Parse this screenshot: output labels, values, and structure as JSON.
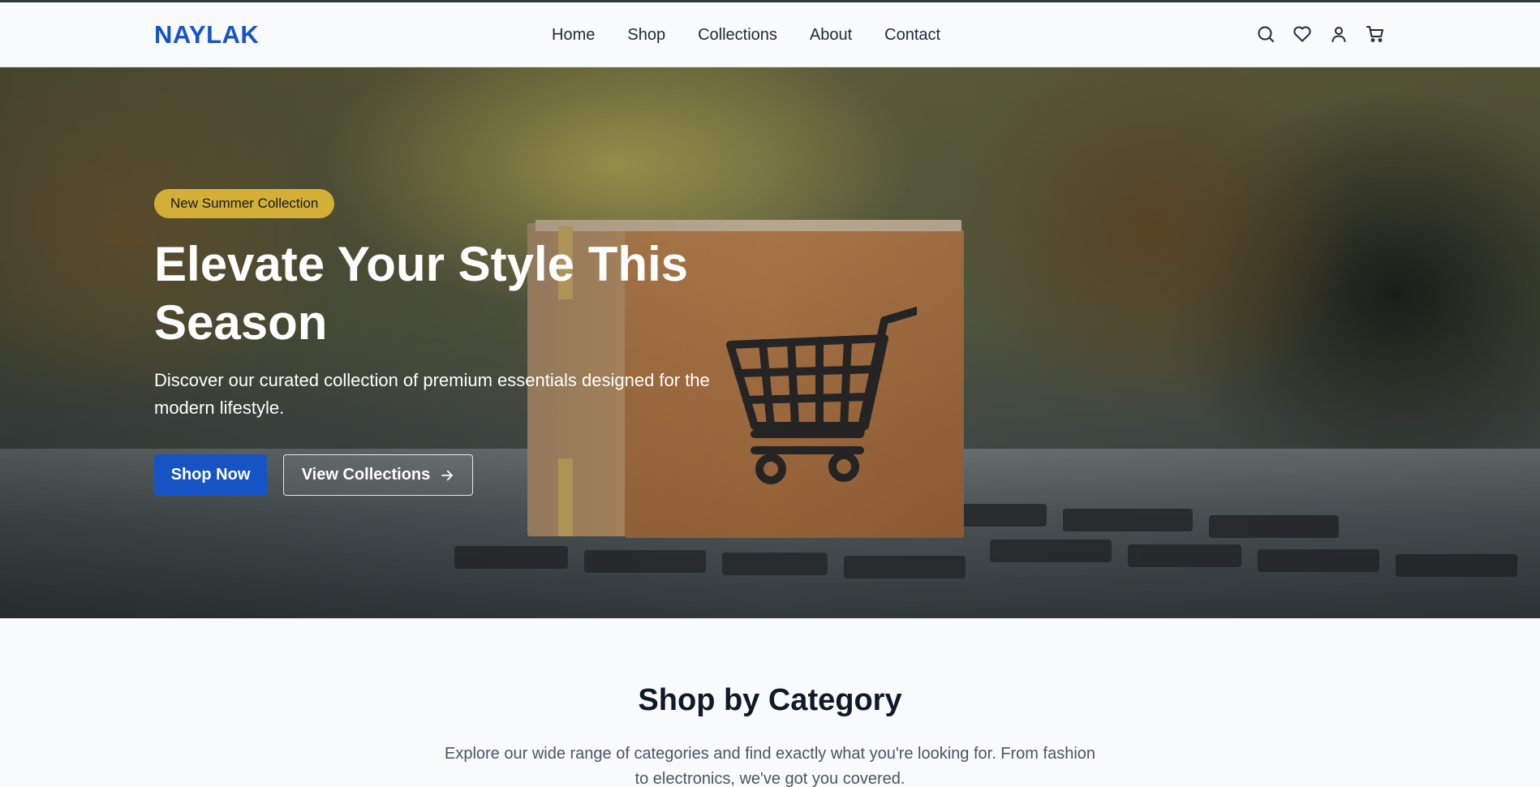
{
  "brand": {
    "logo": "NAYLAK",
    "accent": "#1653c4",
    "badge_color": "#d4af37"
  },
  "nav": {
    "items": [
      "Home",
      "Shop",
      "Collections",
      "About",
      "Contact"
    ]
  },
  "header_icons": [
    "search-icon",
    "heart-icon",
    "user-icon",
    "cart-icon"
  ],
  "hero": {
    "badge": "New Summer Collection",
    "title": "Elevate Your Style This Season",
    "subtitle": "Discover our curated collection of premium essentials designed for the modern lifestyle.",
    "primary_button": "Shop Now",
    "secondary_button": "View Collections"
  },
  "categories": {
    "title": "Shop by Category",
    "description": "Explore our wide range of categories and find exactly what you're looking for. From fashion to electronics, we've got you covered."
  }
}
